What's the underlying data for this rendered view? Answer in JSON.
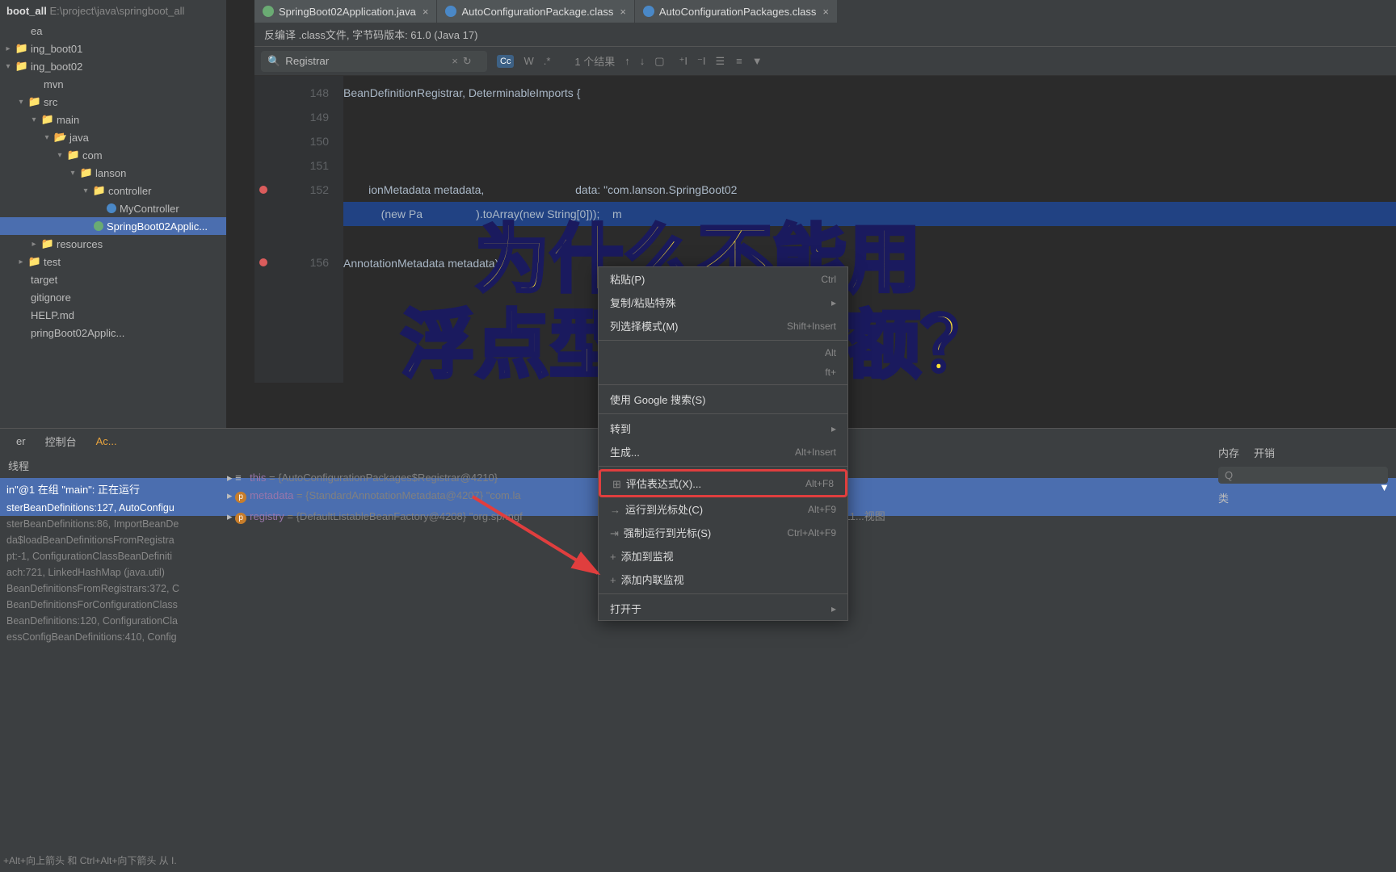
{
  "tabs": [
    {
      "label": "SpringBoot02Application.java",
      "icon": "#6aab73"
    },
    {
      "label": "AutoConfigurationPackage.class",
      "icon": "#4a88c7"
    },
    {
      "label": "AutoConfigurationPackages.class",
      "icon": "#4a88c7"
    }
  ],
  "decompile_bar": "反编译 .class文件, 字节码版本: 61.0 (Java 17)",
  "search": {
    "value": "Registrar",
    "result": "1 个结果",
    "cc": "Cc",
    "w": "W"
  },
  "project": {
    "root_label": "boot_all",
    "root_path": "E:\\project\\java\\springboot_all",
    "nodes": [
      {
        "d": 0,
        "t": "ea"
      },
      {
        "d": 0,
        "t": "ing_boot01",
        "f": true
      },
      {
        "d": 0,
        "t": "ing_boot02",
        "f": true,
        "o": true
      },
      {
        "d": 1,
        "t": "mvn"
      },
      {
        "d": 1,
        "t": "src",
        "f": true,
        "o": true
      },
      {
        "d": 2,
        "t": "main",
        "f": true,
        "o": true
      },
      {
        "d": 3,
        "t": "java",
        "f": true,
        "o": true,
        "blue": true
      },
      {
        "d": 4,
        "t": "com",
        "f": true,
        "o": true
      },
      {
        "d": 5,
        "t": "lanson",
        "f": true,
        "o": true
      },
      {
        "d": 6,
        "t": "controller",
        "f": true,
        "o": true
      },
      {
        "d": 7,
        "t": "MyController",
        "cls": true
      },
      {
        "d": 6,
        "t": "SpringBoot02Applic...",
        "cls": true,
        "sel": true,
        "leaf": true
      },
      {
        "d": 2,
        "t": "resources",
        "f": true,
        "ex": true
      },
      {
        "d": 1,
        "t": "test",
        "f": true
      },
      {
        "d": 0,
        "t": "target"
      },
      {
        "d": 0,
        "t": "gitignore"
      },
      {
        "d": 0,
        "t": "HELP.md"
      },
      {
        "d": 0,
        "t": "pringBoot02Applic..."
      }
    ]
  },
  "code": {
    "lines": [
      {
        "n": "148",
        "t": "BeanDefinitionRegistrar, DeterminableImports {"
      },
      {
        "n": "149",
        "t": ""
      },
      {
        "n": "150",
        "t": ""
      },
      {
        "n": "151",
        "t": ""
      },
      {
        "n": "152",
        "t": "        ionMetadata metadata,                             data: \"com.lanson.SpringBoot02",
        "bp": true
      },
      {
        "n": "",
        "hl": true,
        "t": "            (new Pa                 ).toArray(new String[0]));    m"
      },
      {
        "n": "",
        "t": ""
      },
      {
        "n": "156",
        "t": "AnnotationMetadata metadata) {",
        "bp": true
      }
    ]
  },
  "overlay": {
    "l1": "为什么不能用",
    "l2": "浮点型表示金额？"
  },
  "debug": {
    "tabs": [
      "er",
      "控制台",
      "Ac..."
    ],
    "threads_label": "线程",
    "thread": "in\"@1 在组 \"main\": 正在运行",
    "frames": [
      "sterBeanDefinitions:127, AutoConfigu",
      "sterBeanDefinitions:86, ImportBeanDe",
      "da$loadBeanDefinitionsFromRegistra",
      "pt:-1, ConfigurationClassBeanDefiniti",
      "ach:721, LinkedHashMap (java.util)",
      "BeanDefinitionsFromRegistrars:372, C",
      "BeanDefinitionsForConfigurationClass",
      "BeanDefinitions:120, ConfigurationCla",
      "essConfigBeanDefinitions:410, Config"
    ],
    "vars": [
      {
        "k": "this",
        "v": "= {AutoConfigurationPackages$Registrar@4210}"
      },
      {
        "k": "metadata",
        "v": "= {StandardAnnotationMetadata@4207} \"com.la",
        "p": true
      },
      {
        "k": "registry",
        "v": "= {DefaultListableBeanFactory@4208} \"org.springf",
        "p": true,
        "tail": "bleBeanFactory@4a11...视图"
      }
    ],
    "hint": "+Alt+向上箭头 和 Ctrl+Alt+向下箭头 从 I."
  },
  "menu": [
    {
      "t": "粘贴(P)",
      "s": "Ctrl"
    },
    {
      "t": "复制/粘贴特殊",
      "arr": true
    },
    {
      "t": "列选择模式(M)",
      "s": "Shift+Insert"
    },
    {
      "sep": true
    },
    {
      "t": "",
      "s": "Alt"
    },
    {
      "t": "",
      "s": "ft+"
    },
    {
      "sep": true
    },
    {
      "t": "使用 Google 搜索(S)"
    },
    {
      "sep": true
    },
    {
      "t": "转到",
      "arr": true
    },
    {
      "t": "生成...",
      "s": "Alt+Insert"
    },
    {
      "sep": true
    },
    {
      "t": "评估表达式(X)...",
      "s": "Alt+F8",
      "hi": true,
      "ic": "⊞"
    },
    {
      "t": "运行到光标处(C)",
      "s": "Alt+F9",
      "ic": "→"
    },
    {
      "t": "强制运行到光标(S)",
      "s": "Ctrl+Alt+F9",
      "ic": "⇥"
    },
    {
      "t": "添加到监视",
      "ic": "+"
    },
    {
      "t": "添加内联监视",
      "ic": "+"
    },
    {
      "sep": true
    },
    {
      "t": "打开于",
      "arr": true
    }
  ],
  "memory": {
    "tabs": [
      "内存",
      "开销"
    ],
    "classes_label": "类"
  }
}
